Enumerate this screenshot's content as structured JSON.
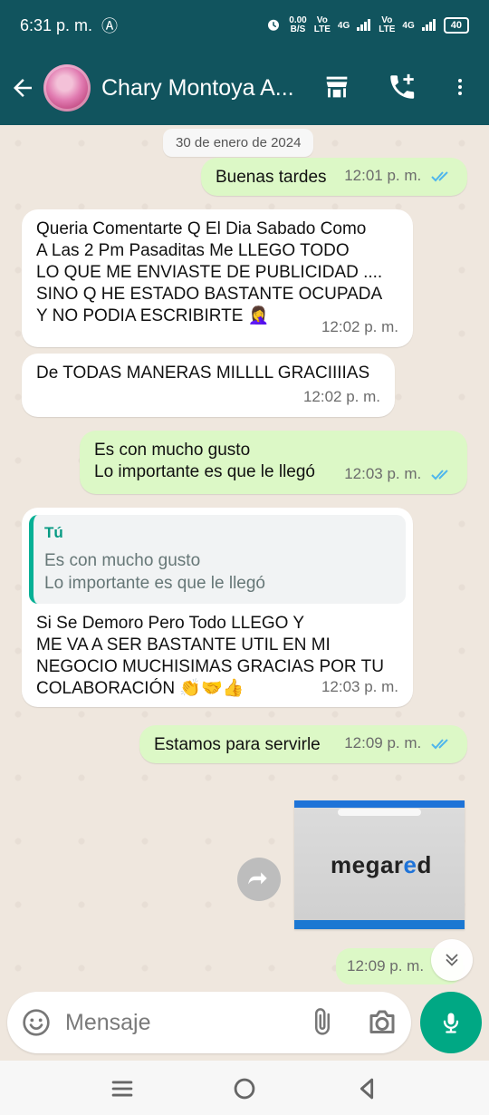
{
  "status_bar": {
    "time": "6:31 p. m.",
    "accessibility": "Ⓐ",
    "speed_top": "0.00",
    "speed_bottom": "B/S",
    "net1_top": "Vo",
    "net1_bottom": "LTE",
    "net1_gen": "4G",
    "net2_top": "Vo",
    "net2_bottom": "LTE",
    "net2_gen": "4G",
    "battery": "40"
  },
  "header": {
    "title": "Chary Montoya A...",
    "icons": [
      "back-icon",
      "store-icon",
      "call-add-icon",
      "more-icon"
    ]
  },
  "chat": {
    "date": "30 de enero de 2024",
    "messages": [
      {
        "direction": "out",
        "text": "Buenas tardes",
        "time": "12:01 p. m."
      },
      {
        "direction": "in",
        "lines": [
          "Queria Comentarte Q El Dia Sabado Como",
          "A Las 2 Pm Pasaditas Me LLEGO TODO",
          "LO QUE ME ENVIASTE DE PUBLICIDAD ....",
          "SINO Q HE ESTADO BASTANTE OCUPADA",
          "Y NO PODIA ESCRIBIRTE 🤦‍♀️"
        ],
        "time": "12:02 p. m."
      },
      {
        "direction": "in",
        "text": "De TODAS MANERAS MILLLL GRACIIIIAS",
        "time": "12:02 p. m."
      },
      {
        "direction": "out",
        "lines": [
          "Es con mucho gusto",
          "Lo importante es que le llegó"
        ],
        "time": "12:03 p. m."
      },
      {
        "direction": "in",
        "quote": {
          "author": "Tú",
          "lines": [
            "Es con mucho gusto",
            "Lo importante es que le llegó"
          ]
        },
        "lines": [
          "Si Se Demoro Pero Todo LLEGO Y",
          "ME VA A SER BASTANTE UTIL EN MI",
          "NEGOCIO MUCHISIMAS GRACIAS POR TU",
          "COLABORACIÓN 👏🤝👍"
        ],
        "time": "12:03 p. m."
      },
      {
        "direction": "out",
        "text": "Estamos para servirle",
        "time": "12:09 p. m."
      },
      {
        "direction": "out",
        "image_brand_before": "megar",
        "image_brand_accent": "e",
        "image_brand_after": "d",
        "time": "12:09 p. m."
      }
    ]
  },
  "composer": {
    "placeholder": "Mensaje"
  },
  "colors": {
    "header": "#11545e",
    "incoming": "#ffffff",
    "outgoing": "#dcf8c6",
    "accent": "#00a884",
    "tick": "#4fb6ec"
  }
}
